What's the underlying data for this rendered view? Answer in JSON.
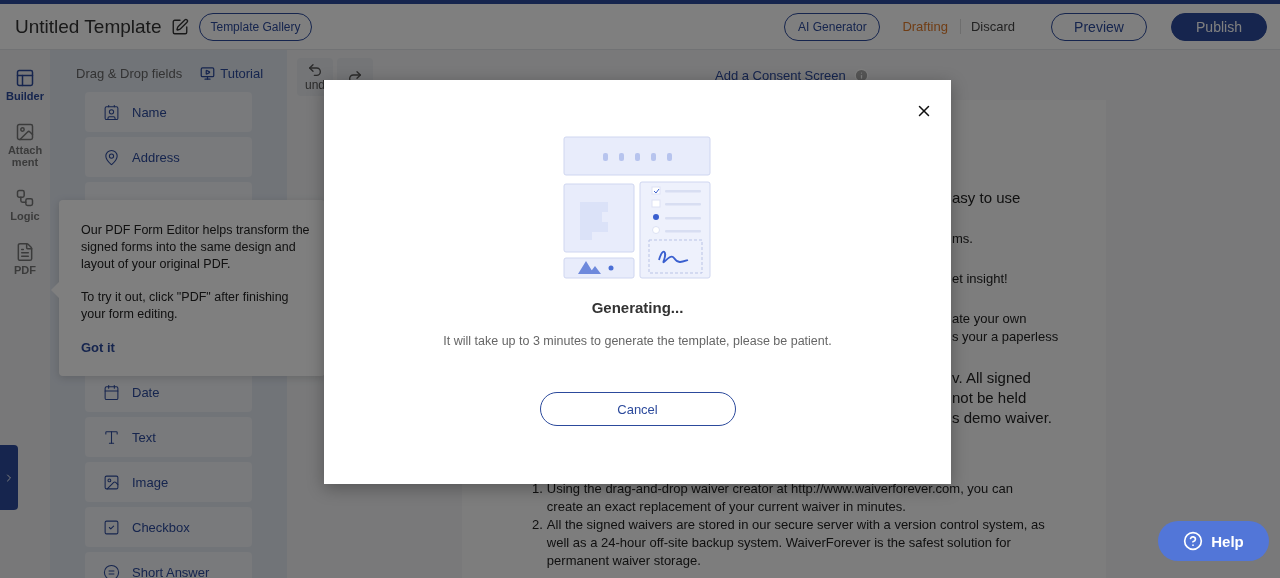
{
  "header": {
    "title": "Untitled Template",
    "gallery_button": "Template Gallery",
    "ai_button": "AI Generator",
    "status": "Drafting",
    "discard": "Discard",
    "preview": "Preview",
    "publish": "Publish"
  },
  "rail": [
    {
      "kind": "builder",
      "label": "Builder",
      "selected": true
    },
    {
      "kind": "attachment",
      "label": "Attachment",
      "selected": false
    },
    {
      "kind": "logic",
      "label": "Logic",
      "selected": false
    },
    {
      "kind": "pdf",
      "label": "PDF",
      "selected": false
    }
  ],
  "fields_panel": {
    "heading": "Drag & Drop fields",
    "tutorial": "Tutorial",
    "fields": [
      {
        "kind": "name",
        "label": "Name"
      },
      {
        "kind": "address",
        "label": "Address"
      },
      {
        "kind": "date",
        "label": "Date"
      },
      {
        "kind": "text",
        "label": "Text"
      },
      {
        "kind": "image",
        "label": "Image"
      },
      {
        "kind": "checkbox",
        "label": "Checkbox"
      },
      {
        "kind": "short_answer",
        "label": "Short Answer"
      }
    ]
  },
  "tooltip": {
    "paragraphs": [
      "Our PDF Form Editor helps transform the signed forms into the same design and layout of your original PDF.",
      "To try it out, click \"PDF\" after finishing your form editing."
    ],
    "action": "Got it"
  },
  "canvas": {
    "undo": "und",
    "consent_link": "Add a Consent Screen",
    "document": {
      "fragments": [
        {
          "kind": "lead",
          "lines": [
            "asy to use"
          ]
        },
        {
          "kind": "body",
          "lines": [
            "ms."
          ]
        },
        {
          "kind": "body",
          "lines": [
            "et insight!"
          ]
        },
        {
          "kind": "body",
          "lines": [
            "ate your own",
            "s your a paperless"
          ]
        },
        {
          "kind": "lead",
          "lines": [
            "v. All signed",
            "not be held",
            "s demo waiver."
          ]
        }
      ],
      "list": [
        {
          "number": "1.",
          "text": "Using the drag-and-drop waiver creator at http://www.waiverforever.com, you can create an exact replacement of your current waiver in minutes."
        },
        {
          "number": "2.",
          "text": "All the signed waivers are stored in our secure server with a version control system, as well as a 24-hour off-site backup system. WaiverForever is the safest solution for permanent waiver storage."
        }
      ]
    }
  },
  "modal": {
    "title": "Generating...",
    "message": "It will take up to 3 minutes to generate the template, please be patient.",
    "cancel": "Cancel"
  },
  "help": "Help"
}
